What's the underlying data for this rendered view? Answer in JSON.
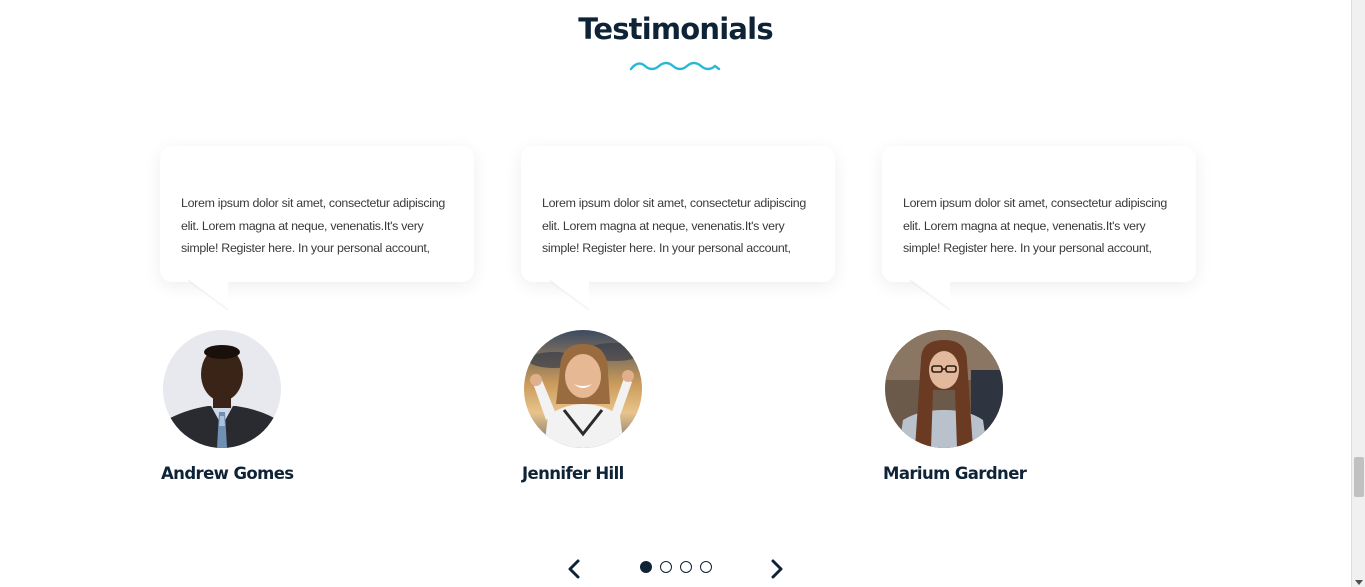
{
  "section": {
    "title": "Testimonials",
    "accent_color": "#27b8d6",
    "heading_color": "#0f2337"
  },
  "testimonials": [
    {
      "quote": "Lorem ipsum dolor sit amet, consectetur adipiscing elit. Lorem magna at neque, venenatis.It's very simple! Register here. In your personal account,",
      "name": "Andrew Gomes",
      "avatar_icon": "man-in-suit-photo"
    },
    {
      "quote": "Lorem ipsum dolor sit amet, consectetur adipiscing elit. Lorem magna at neque, venenatis.It's very simple! Register here. In your personal account,",
      "name": "Jennifer Hill",
      "avatar_icon": "cheering-woman-photo"
    },
    {
      "quote": "Lorem ipsum dolor sit amet, consectetur adipiscing elit. Lorem magna at neque, venenatis.It's very simple! Register here. In your personal account,",
      "name": "Marium Gardner",
      "avatar_icon": "woman-with-glasses-photo"
    }
  ],
  "pager": {
    "prev_icon": "chevron-left-icon",
    "next_icon": "chevron-right-icon",
    "total_pages": 4,
    "current_page": 1
  }
}
